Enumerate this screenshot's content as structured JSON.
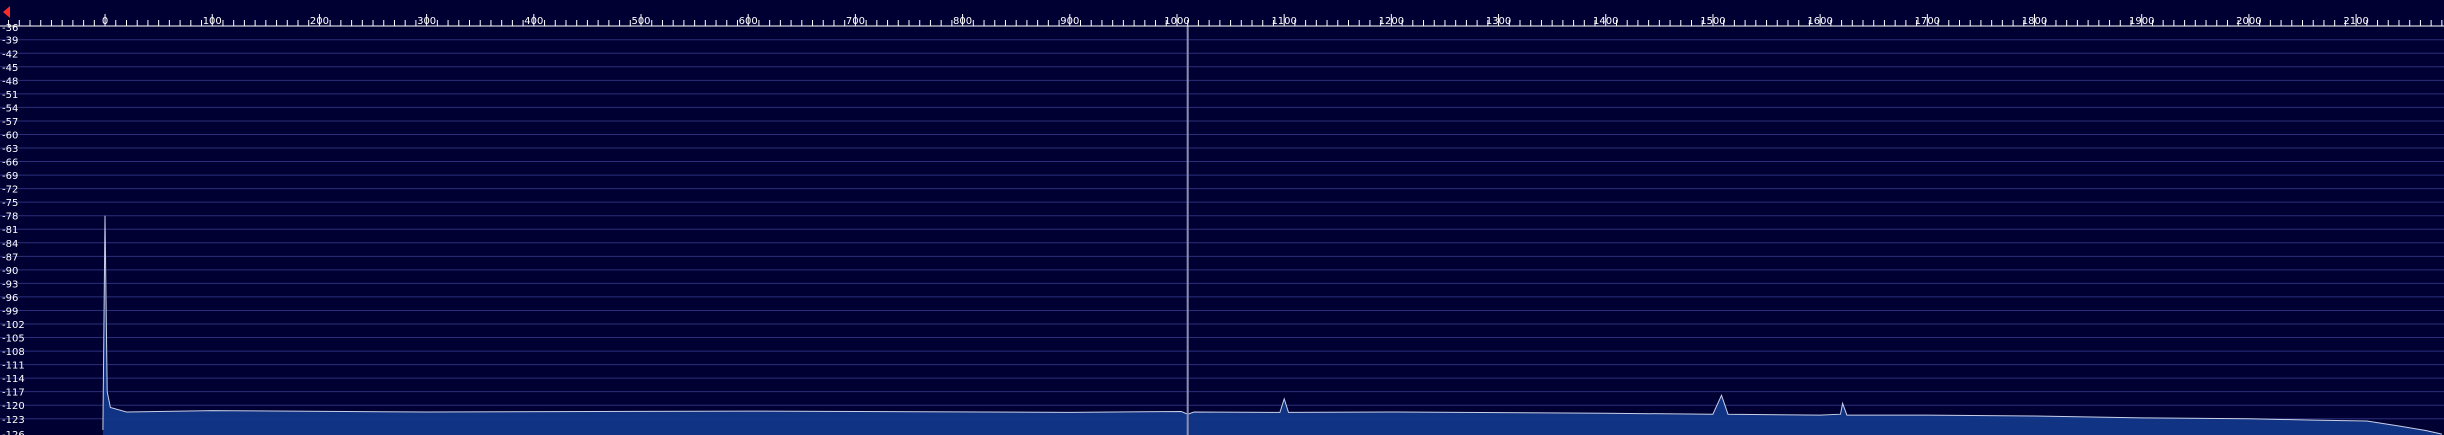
{
  "chart_data": {
    "type": "line",
    "title": "",
    "xlabel": "",
    "ylabel": "",
    "x_ticks": [
      0,
      100,
      200,
      300,
      400,
      500,
      600,
      700,
      800,
      900,
      1000,
      1100,
      1200,
      1300,
      1400,
      1500,
      1600,
      1700,
      1800,
      1900,
      2000,
      2100
    ],
    "y_ticks": [
      -39,
      -42,
      -45,
      -48,
      -51,
      -54,
      -57,
      -60,
      -63,
      -66,
      -69,
      -72,
      -75,
      -78,
      -81,
      -84,
      -87,
      -90,
      -93,
      -96,
      -99,
      -102,
      -105,
      -108,
      -111,
      -114,
      -117,
      -120,
      -123
    ],
    "y_top_partial_label": "-36",
    "y_bottom_partial_label": "-126",
    "xlim": [
      -98,
      2182
    ],
    "ylim": [
      -126.6,
      -36.4
    ],
    "grid": true,
    "cursor_x": 1010,
    "noise_floor_db": -121.5,
    "series": [
      {
        "name": "",
        "points": [
          [
            -2,
            -125.5
          ],
          [
            0,
            -78
          ],
          [
            2,
            -117
          ],
          [
            5,
            -120.5
          ],
          [
            20,
            -121.5
          ],
          [
            100,
            -121.2
          ],
          [
            300,
            -121.5
          ],
          [
            600,
            -121.3
          ],
          [
            900,
            -121.6
          ],
          [
            1004,
            -121.4
          ],
          [
            1010,
            -122
          ],
          [
            1016,
            -121.5
          ],
          [
            1096,
            -121.6
          ],
          [
            1100,
            -118.6
          ],
          [
            1104,
            -121.6
          ],
          [
            1200,
            -121.5
          ],
          [
            1400,
            -121.8
          ],
          [
            1500,
            -122
          ],
          [
            1508,
            -117.8
          ],
          [
            1514,
            -122
          ],
          [
            1600,
            -122.2
          ],
          [
            1619,
            -122
          ],
          [
            1621,
            -119.6
          ],
          [
            1625,
            -122.2
          ],
          [
            1700,
            -122.2
          ],
          [
            1800,
            -122.4
          ],
          [
            1900,
            -122.8
          ],
          [
            2000,
            -123
          ],
          [
            2060,
            -123.3
          ],
          [
            2110,
            -123.5
          ],
          [
            2140,
            -124.6
          ],
          [
            2165,
            -125.6
          ],
          [
            2180,
            -126.4
          ]
        ]
      }
    ],
    "colors": {
      "background": "#000033",
      "grid": "#2b2f7a",
      "trace": "#c9cfe8",
      "fill": "#123a8c",
      "cursor": "#8b8fb0",
      "label": "#ffffff",
      "marker": "#ff2a2a"
    }
  },
  "ui": {
    "frequency_marker_icon": "red-triangle-icon"
  }
}
